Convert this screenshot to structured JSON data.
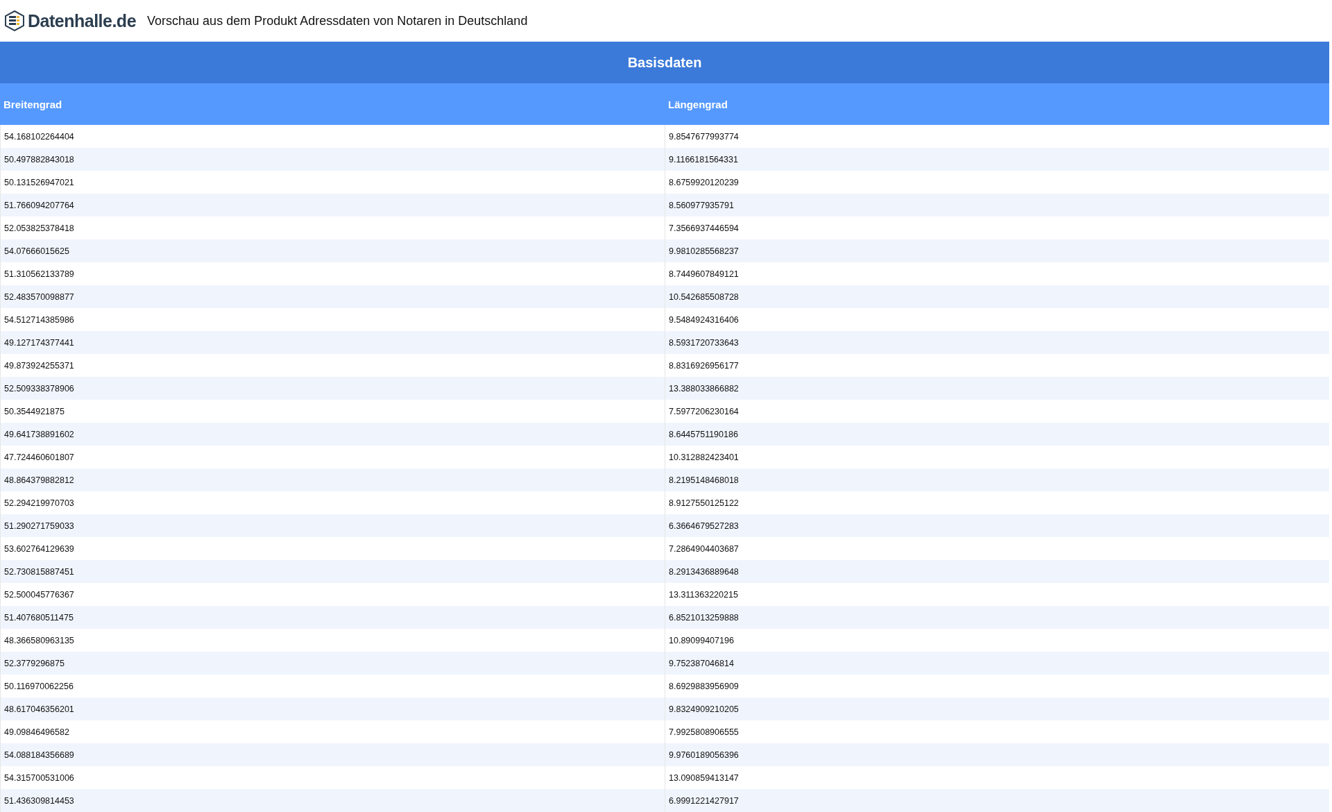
{
  "header": {
    "logo": "Datenhalle.de",
    "title": "Vorschau aus dem Produkt Adressdaten von Notaren in Deutschland"
  },
  "table": {
    "caption": "Basisdaten",
    "columns": [
      "Breitengrad",
      "Längengrad"
    ],
    "rows": [
      [
        "54.168102264404",
        "9.8547677993774"
      ],
      [
        "50.497882843018",
        "9.1166181564331"
      ],
      [
        "50.131526947021",
        "8.6759920120239"
      ],
      [
        "51.766094207764",
        "8.560977935791"
      ],
      [
        "52.053825378418",
        "7.3566937446594"
      ],
      [
        "54.07666015625",
        "9.9810285568237"
      ],
      [
        "51.310562133789",
        "8.7449607849121"
      ],
      [
        "52.483570098877",
        "10.542685508728"
      ],
      [
        "54.512714385986",
        "9.5484924316406"
      ],
      [
        "49.127174377441",
        "8.5931720733643"
      ],
      [
        "49.873924255371",
        "8.8316926956177"
      ],
      [
        "52.509338378906",
        "13.388033866882"
      ],
      [
        "50.3544921875",
        "7.5977206230164"
      ],
      [
        "49.641738891602",
        "8.6445751190186"
      ],
      [
        "47.724460601807",
        "10.312882423401"
      ],
      [
        "48.864379882812",
        "8.2195148468018"
      ],
      [
        "52.294219970703",
        "8.9127550125122"
      ],
      [
        "51.290271759033",
        "6.3664679527283"
      ],
      [
        "53.602764129639",
        "7.2864904403687"
      ],
      [
        "52.730815887451",
        "8.2913436889648"
      ],
      [
        "52.500045776367",
        "13.311363220215"
      ],
      [
        "51.407680511475",
        "6.8521013259888"
      ],
      [
        "48.366580963135",
        "10.89099407196"
      ],
      [
        "52.3779296875",
        "9.752387046814"
      ],
      [
        "50.116970062256",
        "8.6929883956909"
      ],
      [
        "48.617046356201",
        "9.8324909210205"
      ],
      [
        "49.09846496582",
        "7.9925808906555"
      ],
      [
        "54.088184356689",
        "9.9760189056396"
      ],
      [
        "54.315700531006",
        "13.090859413147"
      ],
      [
        "51.436309814453",
        "6.9991221427917"
      ]
    ]
  }
}
